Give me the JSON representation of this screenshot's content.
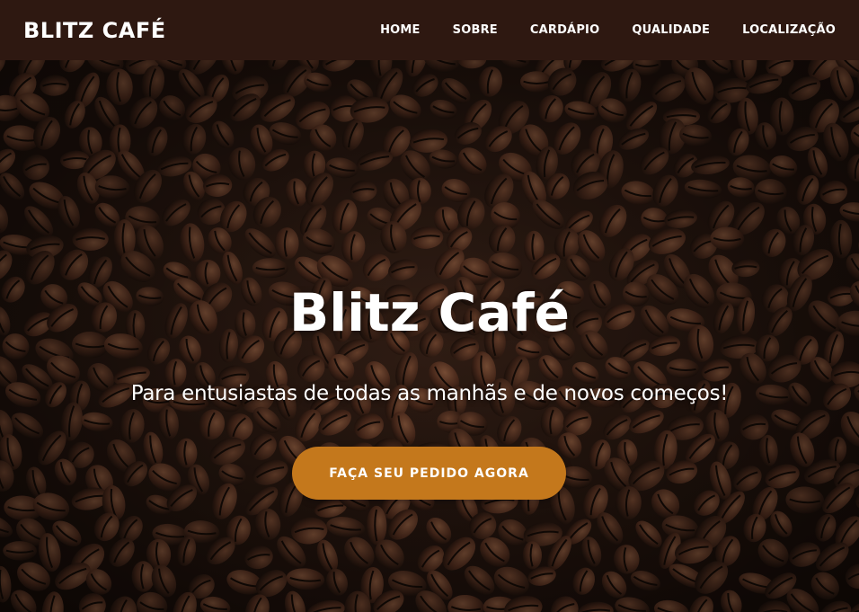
{
  "navbar": {
    "brand": "BLITZ CAFÉ",
    "links": [
      {
        "label": "HOME"
      },
      {
        "label": "SOBRE"
      },
      {
        "label": "CARDÁPIO"
      },
      {
        "label": "QUALIDADE"
      },
      {
        "label": "LOCALIZAÇÃO"
      }
    ]
  },
  "hero": {
    "title": "Blitz Café",
    "subtitle": "Para entusiastas de todas as manhãs e de novos começos!",
    "cta_label": "FAÇA SEU PEDIDO AGORA",
    "background": "coffee-beans-photo"
  },
  "colors": {
    "navbar_bg": "#2e1811",
    "cta_bg": "#c4781c",
    "text": "#ffffff"
  }
}
